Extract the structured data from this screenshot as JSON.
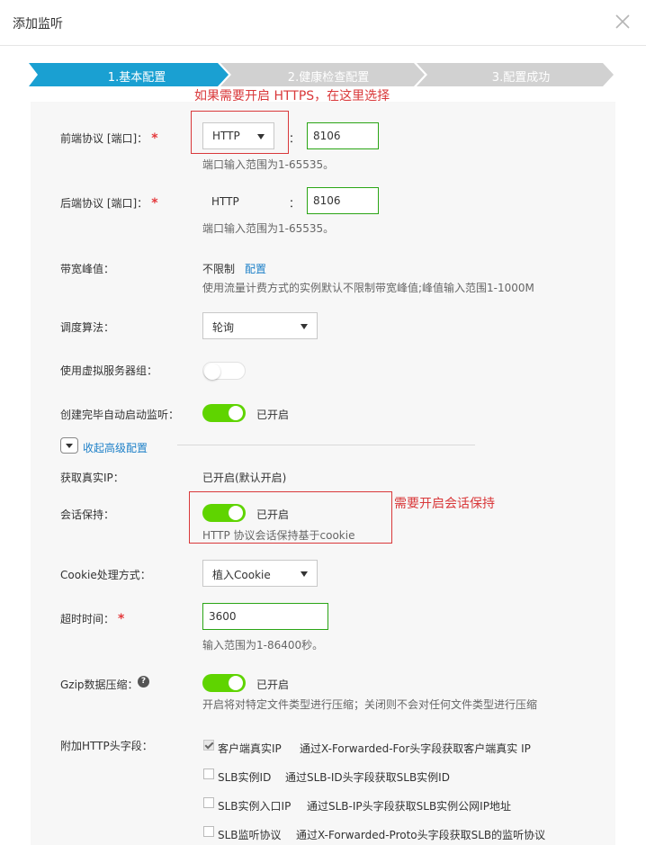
{
  "dialog": {
    "title": "添加监听"
  },
  "steps": [
    {
      "label": "1.基本配置",
      "active": true
    },
    {
      "label": "2.健康检查配置",
      "active": false
    },
    {
      "label": "3.配置成功",
      "active": false
    }
  ],
  "colors": {
    "step_active": "#1aa0d2",
    "step_inactive": "#d1d1d1",
    "toggle_on": "#5fd400",
    "annotation": "#d9383a",
    "input_border": "#2aa515",
    "link": "#1e80c8"
  },
  "annotations": {
    "https": "如果需要开启 HTTPS，在这里选择",
    "session": "需要开启会话保持"
  },
  "frontend": {
    "label": "前端协议 [端口]：",
    "protocol": "HTTP",
    "port": "8106",
    "hint": "端口输入范围为1-65535。"
  },
  "backend": {
    "label": "后端协议 [端口]：",
    "protocol": "HTTP",
    "port": "8106",
    "hint": "端口输入范围为1-65535。"
  },
  "colon": "：",
  "bandwidth": {
    "label": "带宽峰值：",
    "value": "不限制",
    "link": "配置",
    "hint": "使用流量计费方式的实例默认不限制带宽峰值;峰值输入范围1-1000M"
  },
  "scheduler": {
    "label": "调度算法：",
    "value": "轮询"
  },
  "vserver": {
    "label": "使用虚拟服务器组：",
    "enabled": false
  },
  "autostart": {
    "label": "创建完毕自动启动监听：",
    "enabled": true,
    "status": "已开启"
  },
  "advanced": {
    "toggle_label": "收起高级配置"
  },
  "realip": {
    "label": "获取真实IP：",
    "value": "已开启(默认开启)"
  },
  "session": {
    "label": "会话保持：",
    "enabled": true,
    "status": "已开启",
    "hint": "HTTP 协议会话保持基于cookie"
  },
  "cookie": {
    "label": "Cookie处理方式：",
    "value": "植入Cookie"
  },
  "timeout": {
    "label": "超时时间：",
    "value": "3600",
    "hint": "输入范围为1-86400秒。"
  },
  "gzip": {
    "label": "Gzip数据压缩：",
    "help": "?",
    "enabled": true,
    "status": "已开启",
    "hint": "开启将对特定文件类型进行压缩；关闭则不会对任何文件类型进行压缩"
  },
  "headers": {
    "label": "附加HTTP头字段：",
    "items": [
      {
        "name": "客户端真实IP",
        "checked": true,
        "desc": "通过X-Forwarded-For头字段获取客户端真实 IP"
      },
      {
        "name": "SLB实例ID",
        "checked": false,
        "desc": "通过SLB-ID头字段获取SLB实例ID"
      },
      {
        "name": "SLB实例入口IP",
        "checked": false,
        "desc": "通过SLB-IP头字段获取SLB实例公网IP地址"
      },
      {
        "name": "SLB监听协议",
        "checked": false,
        "desc": "通过X-Forwarded-Proto头字段获取SLB的监听协议"
      }
    ]
  }
}
